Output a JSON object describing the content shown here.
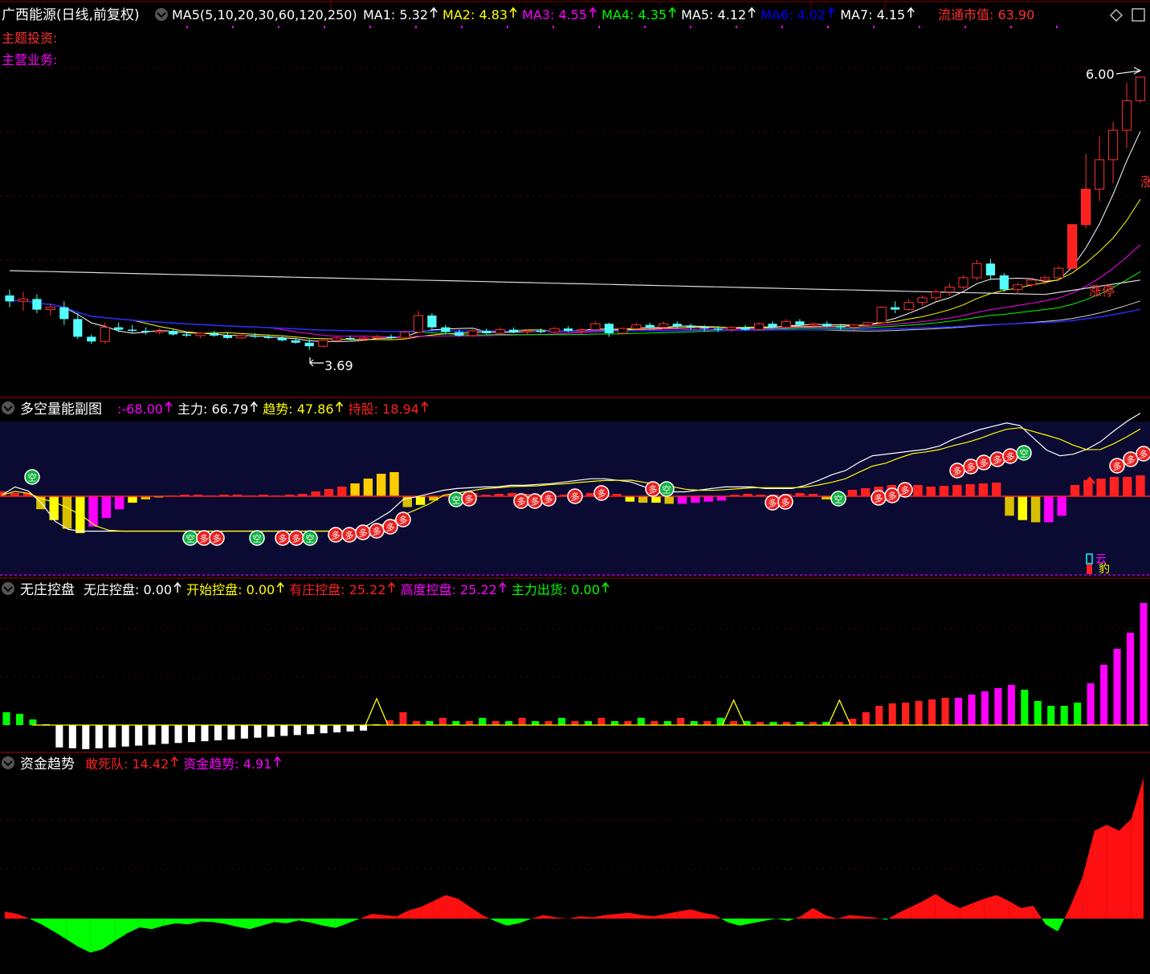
{
  "header": {
    "title": "广西能源(日线,前复权)",
    "ma_label": "MA5(5,10,20,30,60,120,250)",
    "ma_items": [
      {
        "label": "MA1: 5.32",
        "color": "#ffffff"
      },
      {
        "label": "MA2: 4.83",
        "color": "#ffff00"
      },
      {
        "label": "MA3: 4.55",
        "color": "#ff00ff"
      },
      {
        "label": "MA4: 4.35",
        "color": "#00ff00"
      },
      {
        "label": "MA5: 4.12",
        "color": "#ffffff"
      },
      {
        "label": "MA6: 4.02",
        "color": "#0000ff"
      },
      {
        "label": "MA7: 4.15",
        "color": "#ffffff"
      }
    ],
    "market_cap": "流通市值: 63.90",
    "theme_label": "主题投资:",
    "business_label": "主营业务:"
  },
  "main_pane": {
    "high_label": "6.00",
    "low_label": "3.69",
    "limit_up_label": "涨停",
    "edge_label": "涨"
  },
  "pane2": {
    "title": "多空量能副图",
    "items": [
      {
        "label": ":-68.00",
        "color": "#ff00ff"
      },
      {
        "label": "主力: 66.79",
        "color": "#ffffff"
      },
      {
        "label": "趋势: 47.86",
        "color": "#ffff00"
      },
      {
        "label": "持股: 18.94",
        "color": "#ff2020"
      }
    ],
    "bubble_duo": "多",
    "bubble_kong": "空",
    "small_glyphs": [
      "云",
      "豹"
    ]
  },
  "pane3": {
    "title": "无庄控盘",
    "items": [
      {
        "label": "无庄控盘: 0.00",
        "color": "#ffffff"
      },
      {
        "label": "开始控盘: 0.00",
        "color": "#ffff00"
      },
      {
        "label": "有庄控盘: 25.22",
        "color": "#ff2020"
      },
      {
        "label": "高度控盘: 25.22",
        "color": "#ff00ff"
      },
      {
        "label": "主力出货: 0.00",
        "color": "#00ff00"
      }
    ]
  },
  "pane4": {
    "title": "资金趋势",
    "items": [
      {
        "label": "敢死队: 14.42",
        "color": "#ff2020"
      },
      {
        "label": "资金趋势: 4.91",
        "color": "#ff00ff"
      }
    ]
  },
  "chart_data": [
    {
      "type": "candlestick",
      "title": "广西能源(日线,前复权)",
      "ylim": [
        3.4,
        6.5
      ],
      "highlighted_high": 6.0,
      "highlighted_low": 3.69,
      "candles": [
        {
          "o": 4.15,
          "h": 4.2,
          "l": 4.05,
          "c": 4.1
        },
        {
          "o": 4.1,
          "h": 4.18,
          "l": 4.02,
          "c": 4.12
        },
        {
          "o": 4.12,
          "h": 4.16,
          "l": 4.0,
          "c": 4.03
        },
        {
          "o": 4.03,
          "h": 4.08,
          "l": 3.98,
          "c": 4.05
        },
        {
          "o": 4.05,
          "h": 4.1,
          "l": 3.9,
          "c": 3.95
        },
        {
          "o": 3.95,
          "h": 4.0,
          "l": 3.78,
          "c": 3.8
        },
        {
          "o": 3.8,
          "h": 3.82,
          "l": 3.74,
          "c": 3.76
        },
        {
          "o": 3.76,
          "h": 3.92,
          "l": 3.74,
          "c": 3.88
        },
        {
          "o": 3.88,
          "h": 3.92,
          "l": 3.84,
          "c": 3.86
        },
        {
          "o": 3.86,
          "h": 3.9,
          "l": 3.83,
          "c": 3.85
        },
        {
          "o": 3.85,
          "h": 3.88,
          "l": 3.82,
          "c": 3.84
        },
        {
          "o": 3.84,
          "h": 3.87,
          "l": 3.82,
          "c": 3.85
        },
        {
          "o": 3.85,
          "h": 3.86,
          "l": 3.81,
          "c": 3.82
        },
        {
          "o": 3.82,
          "h": 3.84,
          "l": 3.8,
          "c": 3.81
        },
        {
          "o": 3.81,
          "h": 3.84,
          "l": 3.79,
          "c": 3.83
        },
        {
          "o": 3.83,
          "h": 3.85,
          "l": 3.8,
          "c": 3.81
        },
        {
          "o": 3.81,
          "h": 3.83,
          "l": 3.78,
          "c": 3.79
        },
        {
          "o": 3.79,
          "h": 3.82,
          "l": 3.78,
          "c": 3.81
        },
        {
          "o": 3.81,
          "h": 3.83,
          "l": 3.79,
          "c": 3.8
        },
        {
          "o": 3.8,
          "h": 3.82,
          "l": 3.78,
          "c": 3.79
        },
        {
          "o": 3.79,
          "h": 3.81,
          "l": 3.76,
          "c": 3.77
        },
        {
          "o": 3.77,
          "h": 3.79,
          "l": 3.74,
          "c": 3.75
        },
        {
          "o": 3.75,
          "h": 3.78,
          "l": 3.69,
          "c": 3.72
        },
        {
          "o": 3.72,
          "h": 3.78,
          "l": 3.71,
          "c": 3.77
        },
        {
          "o": 3.77,
          "h": 3.8,
          "l": 3.75,
          "c": 3.79
        },
        {
          "o": 3.79,
          "h": 3.81,
          "l": 3.77,
          "c": 3.78
        },
        {
          "o": 3.78,
          "h": 3.8,
          "l": 3.76,
          "c": 3.79
        },
        {
          "o": 3.79,
          "h": 3.82,
          "l": 3.78,
          "c": 3.8
        },
        {
          "o": 3.8,
          "h": 3.82,
          "l": 3.78,
          "c": 3.79
        },
        {
          "o": 3.79,
          "h": 3.85,
          "l": 3.78,
          "c": 3.84
        },
        {
          "o": 3.84,
          "h": 4.02,
          "l": 3.83,
          "c": 3.98
        },
        {
          "o": 3.98,
          "h": 4.0,
          "l": 3.86,
          "c": 3.88
        },
        {
          "o": 3.88,
          "h": 3.9,
          "l": 3.82,
          "c": 3.84
        },
        {
          "o": 3.84,
          "h": 3.86,
          "l": 3.8,
          "c": 3.81
        },
        {
          "o": 3.81,
          "h": 3.86,
          "l": 3.8,
          "c": 3.85
        },
        {
          "o": 3.85,
          "h": 3.87,
          "l": 3.82,
          "c": 3.83
        },
        {
          "o": 3.83,
          "h": 3.88,
          "l": 3.82,
          "c": 3.86
        },
        {
          "o": 3.86,
          "h": 3.88,
          "l": 3.83,
          "c": 3.84
        },
        {
          "o": 3.84,
          "h": 3.86,
          "l": 3.82,
          "c": 3.85
        },
        {
          "o": 3.85,
          "h": 3.87,
          "l": 3.83,
          "c": 3.84
        },
        {
          "o": 3.84,
          "h": 3.88,
          "l": 3.83,
          "c": 3.87
        },
        {
          "o": 3.87,
          "h": 3.89,
          "l": 3.84,
          "c": 3.85
        },
        {
          "o": 3.85,
          "h": 3.87,
          "l": 3.82,
          "c": 3.86
        },
        {
          "o": 3.86,
          "h": 3.93,
          "l": 3.85,
          "c": 3.91
        },
        {
          "o": 3.91,
          "h": 3.92,
          "l": 3.8,
          "c": 3.83
        },
        {
          "o": 3.83,
          "h": 3.88,
          "l": 3.82,
          "c": 3.87
        },
        {
          "o": 3.87,
          "h": 3.92,
          "l": 3.86,
          "c": 3.9
        },
        {
          "o": 3.9,
          "h": 3.92,
          "l": 3.86,
          "c": 3.88
        },
        {
          "o": 3.88,
          "h": 3.93,
          "l": 3.87,
          "c": 3.91
        },
        {
          "o": 3.91,
          "h": 3.93,
          "l": 3.87,
          "c": 3.89
        },
        {
          "o": 3.89,
          "h": 3.91,
          "l": 3.86,
          "c": 3.88
        },
        {
          "o": 3.88,
          "h": 3.9,
          "l": 3.85,
          "c": 3.87
        },
        {
          "o": 3.87,
          "h": 3.89,
          "l": 3.84,
          "c": 3.86
        },
        {
          "o": 3.86,
          "h": 3.89,
          "l": 3.84,
          "c": 3.88
        },
        {
          "o": 3.88,
          "h": 3.9,
          "l": 3.85,
          "c": 3.86
        },
        {
          "o": 3.86,
          "h": 3.92,
          "l": 3.85,
          "c": 3.91
        },
        {
          "o": 3.91,
          "h": 3.93,
          "l": 3.87,
          "c": 3.88
        },
        {
          "o": 3.88,
          "h": 3.95,
          "l": 3.87,
          "c": 3.93
        },
        {
          "o": 3.93,
          "h": 3.95,
          "l": 3.89,
          "c": 3.9
        },
        {
          "o": 3.9,
          "h": 3.92,
          "l": 3.88,
          "c": 3.91
        },
        {
          "o": 3.91,
          "h": 3.93,
          "l": 3.88,
          "c": 3.89
        },
        {
          "o": 3.89,
          "h": 3.91,
          "l": 3.86,
          "c": 3.88
        },
        {
          "o": 3.88,
          "h": 3.91,
          "l": 3.84,
          "c": 3.9
        },
        {
          "o": 3.9,
          "h": 3.93,
          "l": 3.89,
          "c": 3.92
        },
        {
          "o": 3.92,
          "h": 4.06,
          "l": 3.91,
          "c": 4.05
        },
        {
          "o": 4.05,
          "h": 4.1,
          "l": 4.0,
          "c": 4.03
        },
        {
          "o": 4.03,
          "h": 4.12,
          "l": 4.02,
          "c": 4.09
        },
        {
          "o": 4.09,
          "h": 4.15,
          "l": 4.06,
          "c": 4.13
        },
        {
          "o": 4.13,
          "h": 4.2,
          "l": 4.1,
          "c": 4.18
        },
        {
          "o": 4.18,
          "h": 4.25,
          "l": 4.15,
          "c": 4.22
        },
        {
          "o": 4.22,
          "h": 4.32,
          "l": 4.2,
          "c": 4.3
        },
        {
          "o": 4.3,
          "h": 4.45,
          "l": 4.28,
          "c": 4.42
        },
        {
          "o": 4.42,
          "h": 4.46,
          "l": 4.28,
          "c": 4.32
        },
        {
          "o": 4.32,
          "h": 4.34,
          "l": 4.18,
          "c": 4.2
        },
        {
          "o": 4.2,
          "h": 4.26,
          "l": 4.16,
          "c": 4.24
        },
        {
          "o": 4.24,
          "h": 4.3,
          "l": 4.22,
          "c": 4.28
        },
        {
          "o": 4.28,
          "h": 4.32,
          "l": 4.24,
          "c": 4.3
        },
        {
          "o": 4.3,
          "h": 4.4,
          "l": 4.28,
          "c": 4.38
        },
        {
          "o": 4.38,
          "h": 4.75,
          "l": 4.37,
          "c": 4.75
        },
        {
          "o": 4.75,
          "h": 5.35,
          "l": 4.72,
          "c": 5.05
        },
        {
          "o": 5.05,
          "h": 5.5,
          "l": 4.95,
          "c": 5.3
        },
        {
          "o": 5.3,
          "h": 5.62,
          "l": 5.1,
          "c": 5.55
        },
        {
          "o": 5.55,
          "h": 5.95,
          "l": 5.4,
          "c": 5.8
        },
        {
          "o": 5.8,
          "h": 6.0,
          "l": 5.78,
          "c": 6.0
        }
      ],
      "moving_averages": [
        {
          "name": "MA1",
          "value": 5.32,
          "color": "#ffffff"
        },
        {
          "name": "MA2",
          "value": 4.83,
          "color": "#ffff00"
        },
        {
          "name": "MA3",
          "value": 4.55,
          "color": "#ff00ff"
        },
        {
          "name": "MA4",
          "value": 4.35,
          "color": "#00ff00"
        },
        {
          "name": "MA5",
          "value": 4.12,
          "color": "#ffffff"
        },
        {
          "name": "MA6",
          "value": 4.02,
          "color": "#0000ff"
        },
        {
          "name": "MA7",
          "value": 4.15,
          "color": "#ffffff"
        }
      ]
    },
    {
      "type": "bar",
      "title": "多空量能副图",
      "series": [
        {
          "name": "主力",
          "value": 66.79
        },
        {
          "name": "趋势",
          "value": 47.86
        },
        {
          "name": "持股",
          "value": 18.94
        }
      ],
      "histogram": [
        6,
        4,
        4,
        -12,
        -22,
        -30,
        -34,
        -28,
        -20,
        -12,
        -6,
        -3,
        -1,
        1,
        2,
        2,
        1,
        2,
        2,
        1,
        2,
        1,
        2,
        3,
        6,
        9,
        12,
        16,
        22,
        28,
        30,
        -10,
        -8,
        -4,
        2,
        3,
        4,
        2,
        3,
        4,
        3,
        2,
        3,
        2,
        3,
        4,
        2,
        3,
        -5,
        -6,
        -6,
        -7,
        -7,
        -6,
        -5,
        -4,
        2,
        3,
        2,
        2,
        3,
        4,
        3,
        -3,
        4,
        8,
        10,
        12,
        14,
        16,
        14,
        12,
        13,
        14,
        15,
        16,
        17,
        -18,
        -22,
        -24,
        -24,
        -18,
        14,
        20,
        22,
        24,
        24,
        26
      ],
      "main_line": [
        70,
        80,
        75,
        60,
        38,
        28,
        26,
        26,
        26,
        26,
        26,
        26,
        26,
        26,
        26,
        26,
        26,
        26,
        26,
        26,
        26,
        26,
        26,
        26,
        26,
        26,
        26,
        30,
        40,
        50,
        65,
        68,
        72,
        76,
        78,
        79,
        80,
        80,
        82,
        82,
        83,
        84,
        86,
        88,
        90,
        90,
        88,
        86,
        80,
        76,
        74,
        74,
        76,
        78,
        80,
        80,
        80,
        78,
        78,
        78,
        82,
        88,
        95,
        100,
        110,
        118,
        120,
        122,
        124,
        126,
        130,
        138,
        144,
        150,
        154,
        158,
        155,
        140,
        125,
        118,
        120,
        126,
        135,
        148,
        160,
        170
      ]
    },
    {
      "type": "bar",
      "title": "无庄控盘",
      "series": [
        {
          "name": "无庄控盘",
          "value": 0.0
        },
        {
          "name": "开始控盘",
          "value": 0.0
        },
        {
          "name": "有庄控盘",
          "value": 25.22
        },
        {
          "name": "高度控盘",
          "value": 25.22
        },
        {
          "name": "主力出货",
          "value": 0.0
        }
      ]
    },
    {
      "type": "area",
      "title": "资金趋势",
      "series": [
        {
          "name": "敢死队",
          "value": 14.42
        },
        {
          "name": "资金趋势",
          "value": 4.91
        }
      ],
      "values": [
        12,
        8,
        0,
        -10,
        -22,
        -35,
        -48,
        -58,
        -52,
        -38,
        -25,
        -15,
        -18,
        -12,
        -8,
        -10,
        -5,
        -6,
        -9,
        -14,
        -18,
        -12,
        -6,
        -8,
        -3,
        -7,
        -12,
        -16,
        -8,
        0,
        8,
        6,
        4,
        14,
        20,
        30,
        40,
        34,
        20,
        6,
        -4,
        -12,
        -8,
        0,
        6,
        2,
        0,
        4,
        2,
        6,
        8,
        10,
        6,
        4,
        8,
        12,
        16,
        10,
        6,
        -6,
        -12,
        -8,
        -4,
        0,
        -4,
        4,
        18,
        6,
        0,
        6,
        4,
        2,
        -2,
        10,
        20,
        30,
        42,
        28,
        18,
        26,
        34,
        40,
        30,
        18,
        22,
        -10,
        -22,
        20,
        70,
        150,
        160,
        150,
        170,
        240
      ]
    }
  ]
}
